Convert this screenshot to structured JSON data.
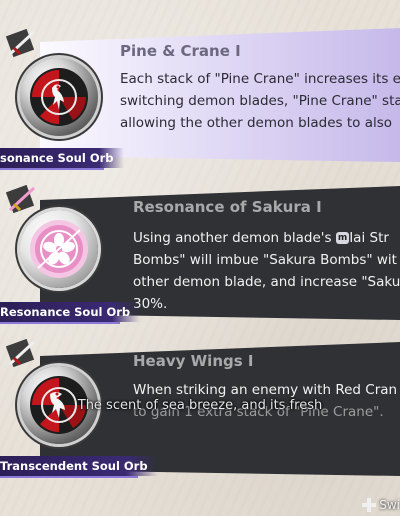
{
  "cards": [
    {
      "title": "Pine & Crane I",
      "desc_lines": [
        "Each stack of \"Pine Crane\" increases its e",
        "switching demon blades, \"Pine Crane\" sta",
        "allowing the other demon blades to also"
      ],
      "orb_type": "Resonance Soul Orb",
      "label_visible": "sonance Soul Orb",
      "icon": "crane-icon",
      "state": "selected"
    },
    {
      "title": "Resonance of Sakura I",
      "desc_lines": [
        "Using another demon blade's",
        "Bombs\" will imbue \"Sakura Bombs\" wit",
        "other demon blade, and increase \"Saku",
        "30%."
      ],
      "desc_after_button": "Iai Str",
      "button_glyph": "m",
      "orb_type": "Resonance Soul Orb",
      "icon": "sakura-icon",
      "state": "normal"
    },
    {
      "title": "Heavy Wings I",
      "desc_lines": [
        "When striking an enemy with Red Cran",
        "to gain 1 extra stack of \"Pine Crane\"."
      ],
      "orb_type": "Transcendent Soul Orb",
      "icon": "crane-icon",
      "state": "normal"
    }
  ],
  "subtitle": "The scent of sea breeze, and its fresh",
  "footer": {
    "switch_label": "Swi"
  },
  "colors": {
    "selected_panel": "#e3dcf6",
    "panel": "#2f3134",
    "label_bg": "#2c1f58",
    "orb_red": "#c3161c",
    "orb_pink": "#e88fc5"
  }
}
